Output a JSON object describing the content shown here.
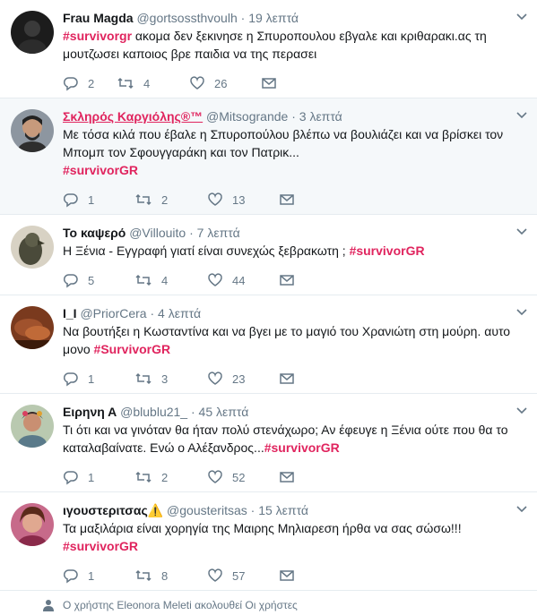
{
  "tweets": [
    {
      "name": "Frau Magda",
      "handle": "@gortsossthvoulh",
      "time": "19 λεπτά",
      "text_parts": [
        {
          "t": "#survivorgr",
          "tag": true
        },
        {
          "t": " ακομα δεν ξεκινησε η Σπυροπουλου εβγαλε και κριθαρακι.ας τη μουτζωσει καποιος βρε παιδια να της περασει",
          "tag": false
        }
      ],
      "replies": "2",
      "retweets": "4",
      "likes": "26"
    },
    {
      "name": "Σκληρός Καργιόλης®™",
      "handle": "@Mitsogrande",
      "time": "3 λεπτά",
      "text_parts": [
        {
          "t": "Με τόσα κιλά που έβαλε η Σπυροπούλου βλέπω να βουλιάζει και να βρίσκει τον Μπομπ τον Σφουγγαράκη και τον Πατρικ...",
          "tag": false
        },
        {
          "t": "#survivorGR",
          "tag": true,
          "br": true
        }
      ],
      "replies": "1",
      "retweets": "2",
      "likes": "13"
    },
    {
      "name": "Το καψερό",
      "handle": "@Villouito",
      "time": "7 λεπτά",
      "text_parts": [
        {
          "t": "Η Ξένια - Εγγραφή γιατί είναι συνεχώς ξεβρακωτη ; ",
          "tag": false
        },
        {
          "t": "#survivorGR",
          "tag": true
        }
      ],
      "replies": "5",
      "retweets": "4",
      "likes": "44"
    },
    {
      "name": "I_I",
      "handle": "@PriorCera",
      "time": "4 λεπτά",
      "text_parts": [
        {
          "t": "Να βουτήξει η Κωσταντίνα και να βγει με το μαγιό του Χρανιώτη στη μούρη. αυτο μονο ",
          "tag": false
        },
        {
          "t": "#SurvivorGR",
          "tag": true
        }
      ],
      "replies": "1",
      "retweets": "3",
      "likes": "23"
    },
    {
      "name": "Ειρηνη Α",
      "handle": "@blublu21_",
      "time": "45 λεπτά",
      "text_parts": [
        {
          "t": "Τι ότι και να γινόταν θα ήταν πολύ στενάχωρο; Αν έφευγε η Ξένια ούτε που θα το καταλαβαίνατε. Ενώ ο Αλέξανδρος...",
          "tag": false
        },
        {
          "t": "#survivorGR",
          "tag": true
        }
      ],
      "replies": "1",
      "retweets": "2",
      "likes": "52"
    },
    {
      "name": "ιγουστεριτσας⚠️",
      "handle": "@gousteritsas",
      "time": "15 λεπτά",
      "text_parts": [
        {
          "t": "Τα μαξιλάρια είναι χορηγία της Μαιρης Μηλιαρεση ήρθα να σας σώσω!!!",
          "tag": false
        },
        {
          "t": "#survivorGR",
          "tag": true,
          "br": true
        }
      ],
      "replies": "1",
      "retweets": "8",
      "likes": "57"
    }
  ],
  "notice": "Ο χρήστης Eleonora Meleti ακολουθεί Οι χρήστες",
  "colors": {
    "accent": "#e0245e",
    "muted": "#657786",
    "highlight_bg": "#f5f8fa"
  }
}
